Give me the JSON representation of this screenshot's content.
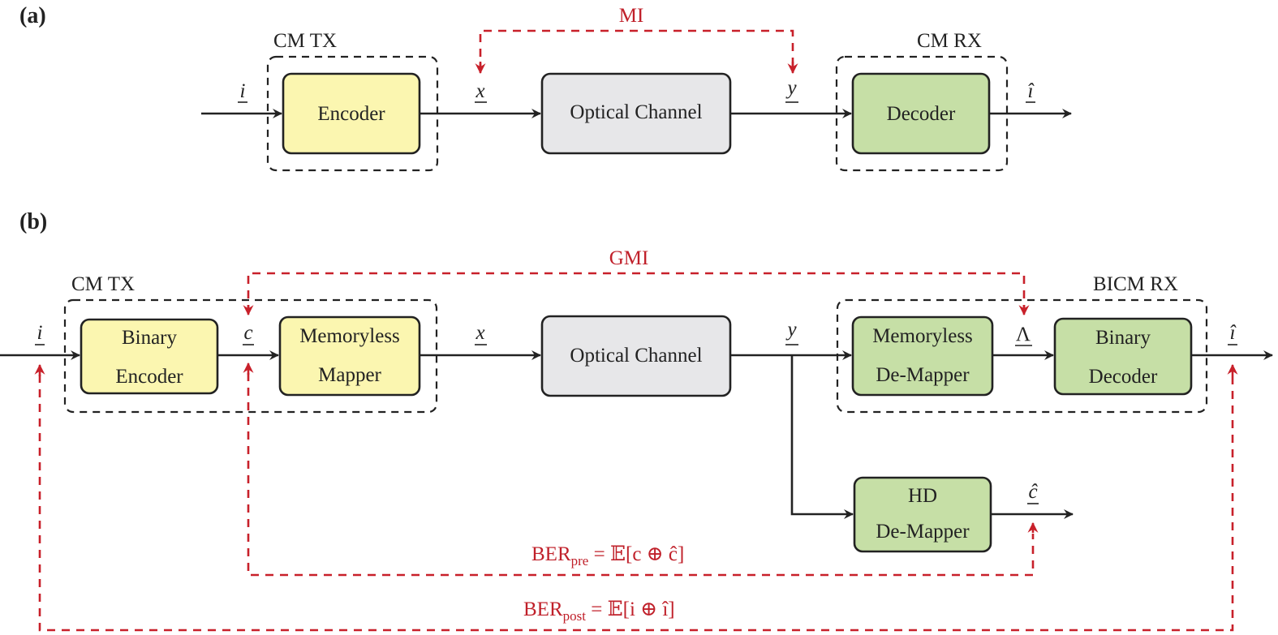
{
  "panels": {
    "a": {
      "label": "(a)",
      "groups": {
        "tx": "CM TX",
        "rx": "CM RX"
      },
      "blocks": {
        "encoder": "Encoder",
        "channel": "Optical Channel",
        "decoder": "Decoder"
      },
      "signals": {
        "input": "i",
        "tx_out": "x",
        "rx_in": "y",
        "output": "î"
      },
      "metric": "MI"
    },
    "b": {
      "label": "(b)",
      "groups": {
        "tx": "CM TX",
        "rx": "BICM RX"
      },
      "blocks": {
        "binary_encoder": [
          "Binary",
          "Encoder"
        ],
        "mapper": [
          "Memoryless",
          "Mapper"
        ],
        "channel": "Optical Channel",
        "demapper": [
          "Memoryless",
          "De-Mapper"
        ],
        "binary_decoder": [
          "Binary",
          "Decoder"
        ],
        "hd_demapper": [
          "HD",
          "De-Mapper"
        ]
      },
      "signals": {
        "input": "i",
        "coded": "c",
        "tx_out": "x",
        "rx_in": "y",
        "llr": "Λ",
        "output": "î",
        "hd_out": "ĉ"
      },
      "metrics": {
        "gmi": "GMI",
        "ber_pre": {
          "base": "BER",
          "sub": "pre",
          "expr": " = 𝔼[c ⊕ ĉ]"
        },
        "ber_post": {
          "base": "BER",
          "sub": "post",
          "expr": " = 𝔼[i ⊕ î]"
        }
      }
    }
  },
  "colors": {
    "tx_block": "#fbf6b0",
    "channel_block": "#e7e7e9",
    "rx_block": "#c6dfa6",
    "metric": "#c0202a"
  }
}
